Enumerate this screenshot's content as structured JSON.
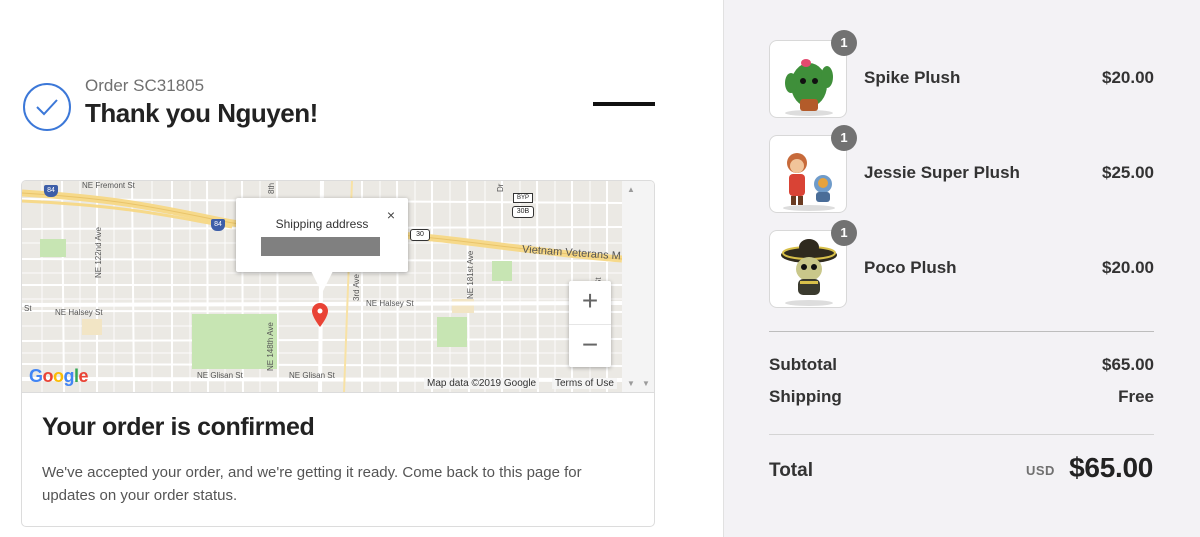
{
  "header": {
    "order_number": "Order SC31805",
    "thank_you": "Thank you Nguyen!"
  },
  "map": {
    "bubble_title": "Shipping address",
    "bubble_close": "×",
    "zoom_in": "+",
    "zoom_out": "−",
    "attribution": "Map data ©2019 Google",
    "terms": "Terms of Use",
    "streets": {
      "fremont": "NE Fremont St",
      "halsey_left": "NE Halsey St",
      "halsey_right": "NE Halsey St",
      "glisan1": "NE Glisan St",
      "glisan2": "NE Glisan St",
      "ave122": "NE 122nd Ave",
      "ave148": "NE 148th Ave",
      "ave181": "NE 181st Ave",
      "vietnam": "Vietnam Veterans M",
      "st": "St",
      "ave_8th": "8th",
      "ave_3rd": "3rd Ave",
      "dr": "Dr"
    },
    "shields": {
      "i84a": "84",
      "i84b": "84",
      "us30": "30",
      "us30b": "30B",
      "byp": "BYP"
    },
    "logo_letters": [
      "G",
      "o",
      "o",
      "g",
      "l",
      "e"
    ],
    "colors": {
      "pin": "#e94335",
      "land": "#ebe9e4",
      "park": "#c7e5b3",
      "highway": "#f6d98a"
    }
  },
  "confirmation": {
    "title": "Your order is confirmed",
    "text": "We've accepted your order, and we're getting it ready. Come back to this page for updates on your order status."
  },
  "cart": {
    "items": [
      {
        "name": "Spike Plush",
        "price": "$20.00",
        "qty": "1",
        "icon": "cactus-plush-image"
      },
      {
        "name": "Jessie Super Plush",
        "price": "$25.00",
        "qty": "1",
        "icon": "jessie-plush-image"
      },
      {
        "name": "Poco Plush",
        "price": "$20.00",
        "qty": "1",
        "icon": "poco-plush-image"
      }
    ],
    "subtotal_label": "Subtotal",
    "subtotal_value": "$65.00",
    "shipping_label": "Shipping",
    "shipping_value": "Free",
    "total_label": "Total",
    "currency": "USD",
    "total_value": "$65.00"
  },
  "colors": {
    "accent": "#3c78d8",
    "sidebar_bg": "#f3f2f5",
    "qty_badge": "#727272"
  }
}
